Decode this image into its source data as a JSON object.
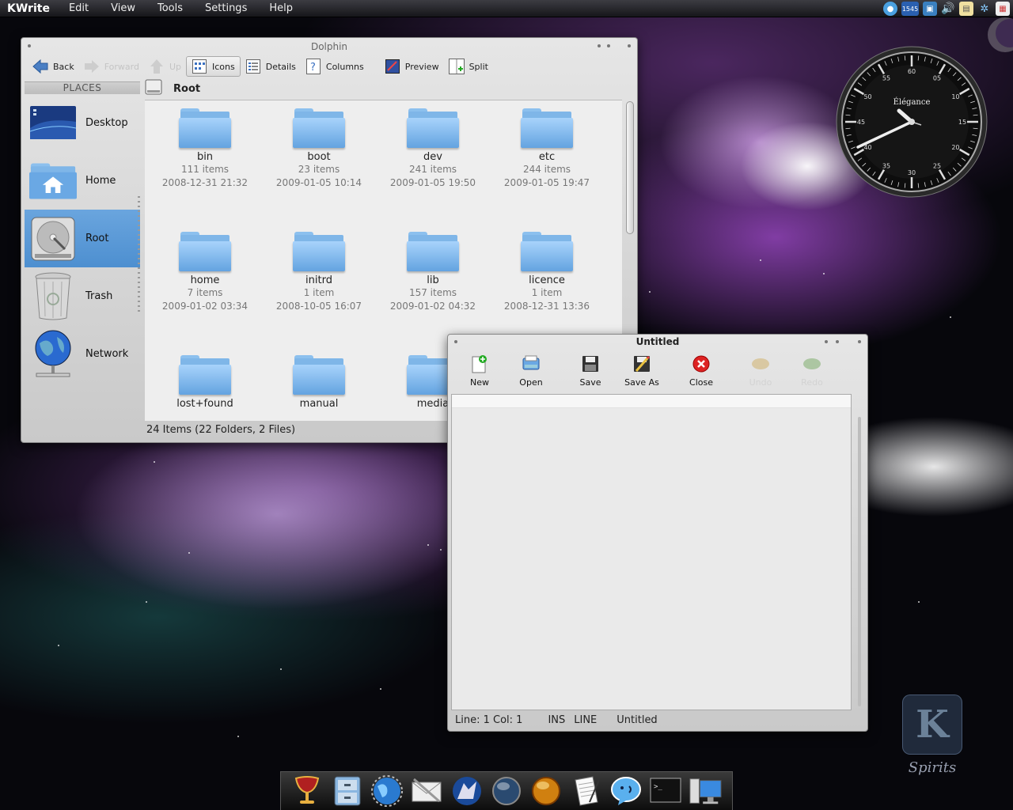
{
  "menubar": {
    "app_name": "KWrite",
    "items": [
      "Edit",
      "View",
      "Tools",
      "Settings",
      "Help"
    ],
    "tray_badge": "1545"
  },
  "dolphin": {
    "title": "Dolphin",
    "toolbar": {
      "back": "Back",
      "forward": "Forward",
      "up": "Up",
      "icons": "Icons",
      "details": "Details",
      "columns": "Columns",
      "preview": "Preview",
      "split": "Split"
    },
    "places_title": "PLACES",
    "places": [
      {
        "label": "Desktop",
        "icon": "desktop-icon"
      },
      {
        "label": "Home",
        "icon": "home-icon"
      },
      {
        "label": "Root",
        "icon": "harddisk-icon",
        "selected": true
      },
      {
        "label": "Trash",
        "icon": "trash-icon"
      },
      {
        "label": "Network",
        "icon": "network-icon"
      }
    ],
    "location": "Root",
    "files": [
      {
        "name": "bin",
        "count": "111 items",
        "date": "2008-12-31 21:32"
      },
      {
        "name": "boot",
        "count": "23 items",
        "date": "2009-01-05 10:14"
      },
      {
        "name": "dev",
        "count": "241 items",
        "date": "2009-01-05 19:50"
      },
      {
        "name": "etc",
        "count": "244 items",
        "date": "2009-01-05 19:47"
      },
      {
        "name": "home",
        "count": "7 items",
        "date": "2009-01-02 03:34"
      },
      {
        "name": "initrd",
        "count": "1 item",
        "date": "2008-10-05 16:07"
      },
      {
        "name": "lib",
        "count": "157 items",
        "date": "2009-01-02 04:32"
      },
      {
        "name": "licence",
        "count": "1 item",
        "date": "2008-12-31 13:36"
      },
      {
        "name": "lost+found",
        "count": "",
        "date": ""
      },
      {
        "name": "manual",
        "count": "",
        "date": ""
      },
      {
        "name": "media",
        "count": "",
        "date": ""
      }
    ],
    "status": "24 Items (22 Folders, 2 Files)"
  },
  "kwrite": {
    "title": "Untitled",
    "toolbar": {
      "new": "New",
      "open": "Open",
      "save": "Save",
      "save_as": "Save As",
      "close": "Close",
      "undo": "Undo",
      "redo": "Redo"
    },
    "status": {
      "position": "Line: 1 Col: 1",
      "mode": "INS",
      "select_mode": "LINE",
      "document": "Untitled"
    }
  },
  "clock": {
    "brand": "Élégance",
    "numerals": [
      "60",
      "05",
      "10",
      "15",
      "20",
      "25",
      "30",
      "35",
      "40",
      "45",
      "50",
      "55"
    ]
  },
  "spirits": {
    "label": "Spirits"
  },
  "dock": {
    "items": [
      "chalice-icon",
      "file-cabinet-icon",
      "globe-icon",
      "mail-icon",
      "wolf-icon",
      "sphere-icon",
      "amber-sphere-icon",
      "text-editor-icon",
      "chat-icon",
      "terminal-icon",
      "computer-icon"
    ]
  },
  "colors": {
    "selection": "#5a9ad7",
    "folder": "#7fb6e8"
  }
}
